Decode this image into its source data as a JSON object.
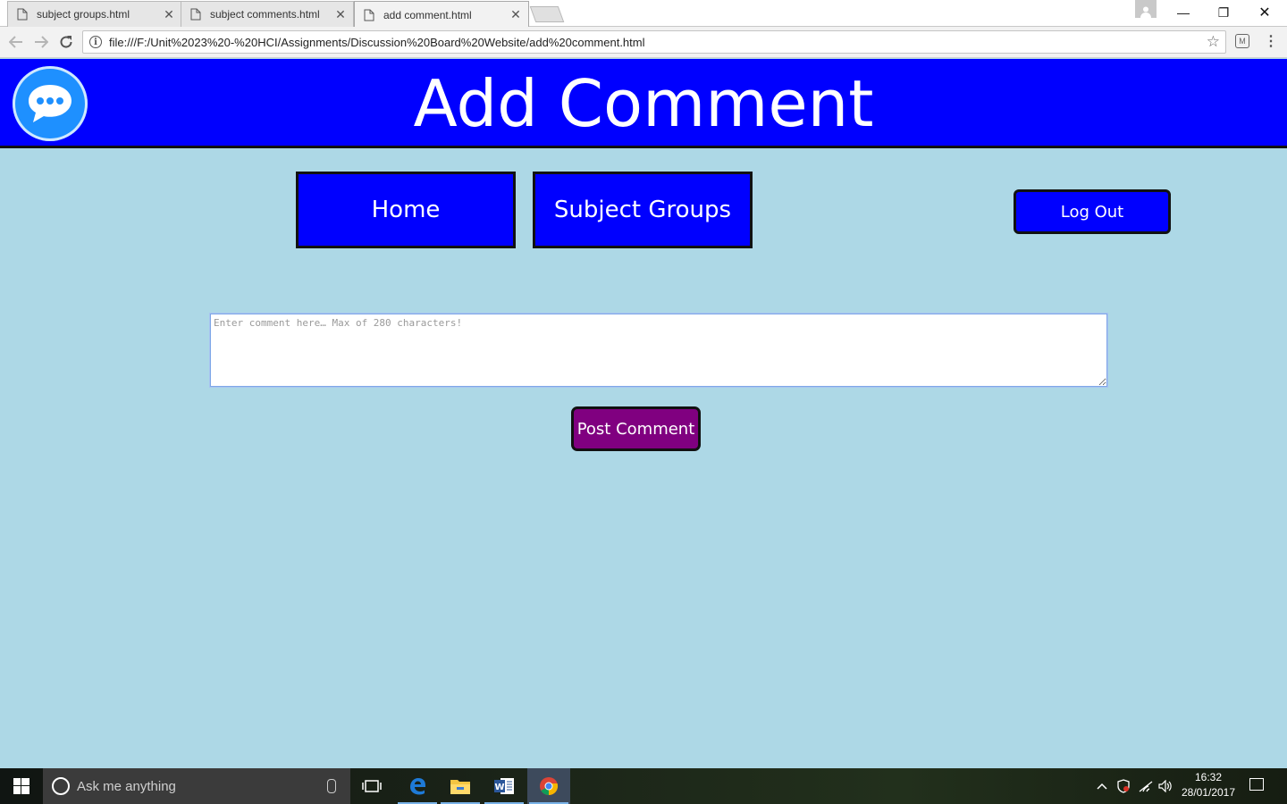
{
  "browser": {
    "tabs": [
      {
        "title": "subject groups.html",
        "close": "✕"
      },
      {
        "title": "subject comments.html",
        "close": "✕"
      },
      {
        "title": "add comment.html",
        "close": "✕"
      }
    ],
    "url": "file:///F:/Unit%2023%20-%20HCI/Assignments/Discussion%20Board%20Website/add%20comment.html",
    "window_controls": {
      "minimize": "—",
      "restore": "❐",
      "close": "✕"
    },
    "icons": {
      "back": "back-arrow-icon",
      "forward": "forward-arrow-icon",
      "reload": "reload-icon",
      "star": "star-icon",
      "menu": "kebab-menu-icon"
    }
  },
  "page": {
    "title": "Add Comment",
    "nav": {
      "home": "Home",
      "subject_groups": "Subject Groups",
      "logout": "Log Out"
    },
    "comment": {
      "placeholder": "Enter comment here… Max of 280 characters!",
      "value": ""
    },
    "post_button": "Post Comment",
    "colors": {
      "background": "#add8e6",
      "header": "#0000ff",
      "nav_button": "#0000ff",
      "post_button": "#800080"
    }
  },
  "taskbar": {
    "search_placeholder": "Ask me anything",
    "time": "16:32",
    "date": "28/01/2017",
    "apps": [
      "task-view",
      "edge",
      "file-explorer",
      "word",
      "chrome"
    ]
  }
}
